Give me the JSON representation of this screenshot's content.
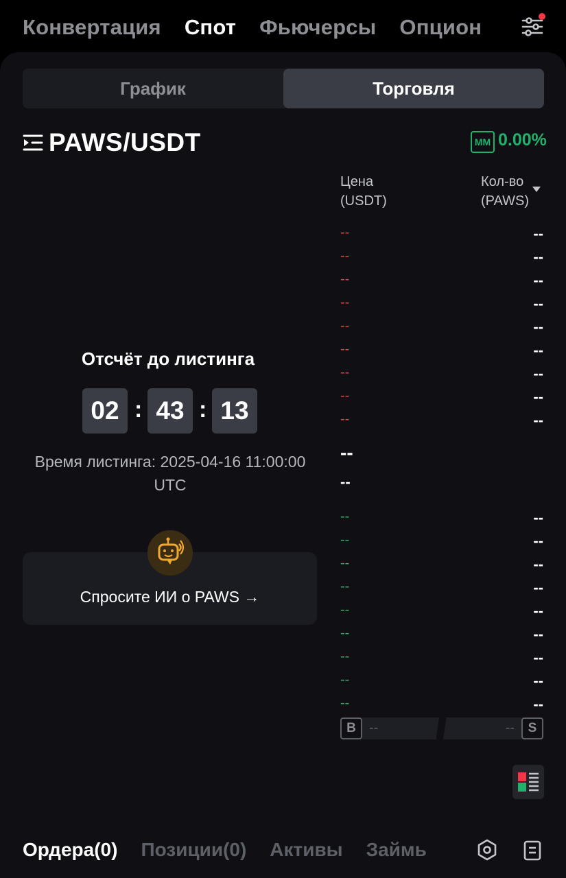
{
  "top_nav": {
    "tabs": [
      {
        "label": "Конвертация",
        "active": false
      },
      {
        "label": "Спот",
        "active": true
      },
      {
        "label": "Фьючерсы",
        "active": false
      },
      {
        "label": "Опцион",
        "active": false
      }
    ],
    "settings_icon": "sliders-icon"
  },
  "segment": {
    "chart_label": "График",
    "trade_label": "Торговля",
    "active": "trade"
  },
  "pair": {
    "name": "PAWS/USDT",
    "mm_badge": "MM",
    "change": "0.00%",
    "colors": {
      "up": "#20b26c",
      "down": "#f23645"
    }
  },
  "orderbook": {
    "price_header_1": "Цена",
    "price_header_2": "(USDT)",
    "qty_header_1": "Кол-во",
    "qty_header_2": "(PAWS)",
    "asks": [
      {
        "price": "--",
        "qty": "--"
      },
      {
        "price": "--",
        "qty": "--"
      },
      {
        "price": "--",
        "qty": "--"
      },
      {
        "price": "--",
        "qty": "--"
      },
      {
        "price": "--",
        "qty": "--"
      },
      {
        "price": "--",
        "qty": "--"
      },
      {
        "price": "--",
        "qty": "--"
      },
      {
        "price": "--",
        "qty": "--"
      },
      {
        "price": "--",
        "qty": "--"
      }
    ],
    "mid_price": "--",
    "mid_sub": "--",
    "bids": [
      {
        "price": "--",
        "qty": "--"
      },
      {
        "price": "--",
        "qty": "--"
      },
      {
        "price": "--",
        "qty": "--"
      },
      {
        "price": "--",
        "qty": "--"
      },
      {
        "price": "--",
        "qty": "--"
      },
      {
        "price": "--",
        "qty": "--"
      },
      {
        "price": "--",
        "qty": "--"
      },
      {
        "price": "--",
        "qty": "--"
      },
      {
        "price": "--",
        "qty": "--"
      }
    ],
    "buy_badge": "B",
    "sell_badge": "S",
    "buy_ratio": "--",
    "sell_ratio": "--"
  },
  "countdown": {
    "title": "Отсчёт до листинга",
    "hours": "02",
    "minutes": "43",
    "seconds": "13",
    "separator": ":",
    "listing_time_line1": "Время листинга: 2025-04-16 11:00:00",
    "listing_time_line2": "UTC"
  },
  "ai": {
    "prompt": "Спросите ИИ о PAWS →",
    "icon": "robot-icon"
  },
  "bottom_tabs": {
    "tabs": [
      {
        "label": "Ордера(0)",
        "active": true
      },
      {
        "label": "Позиции(0)",
        "active": false
      },
      {
        "label": "Активы",
        "active": false
      },
      {
        "label": "Займь",
        "active": false
      }
    ]
  }
}
